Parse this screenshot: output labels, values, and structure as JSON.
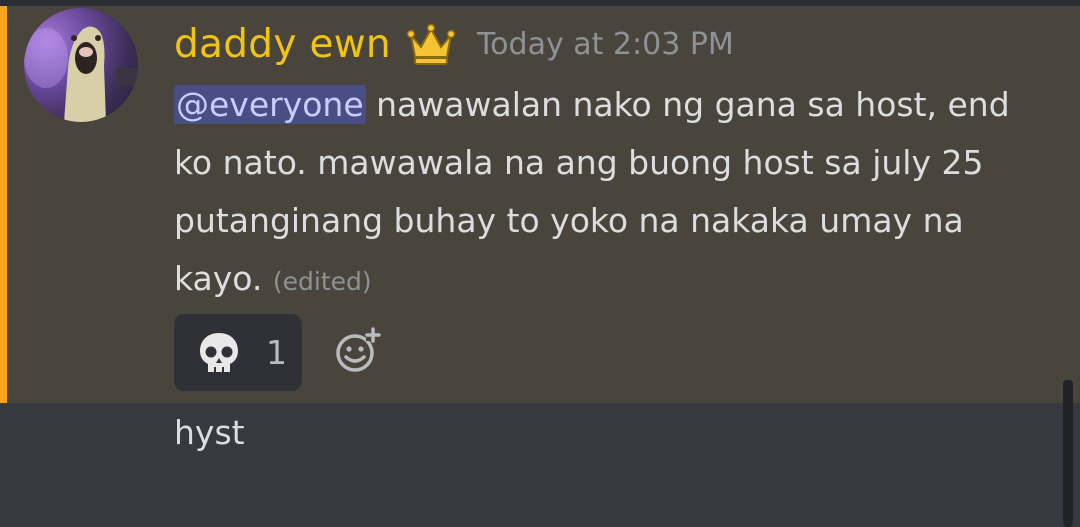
{
  "message": {
    "author": "daddy ewn",
    "author_color": "#f1c40f",
    "badge_icon": "crown-icon",
    "timestamp": "Today at 2:03 PM",
    "mention": "@everyone",
    "text_after_mention": " nawawalan nako ng gana sa host, end ko nato. mawawala na ang buong host sa july 25 putanginang buhay to yoko na nakaka umay na kayo.",
    "edited_label": "(edited)",
    "highlight_color": "#49443c",
    "mention_bar_color": "#faa61a",
    "reactions": [
      {
        "emoji_icon": "skull-icon",
        "count": "1"
      }
    ],
    "add_reaction_icon": "add-reaction-icon"
  },
  "next_message": {
    "text": "hyst"
  }
}
